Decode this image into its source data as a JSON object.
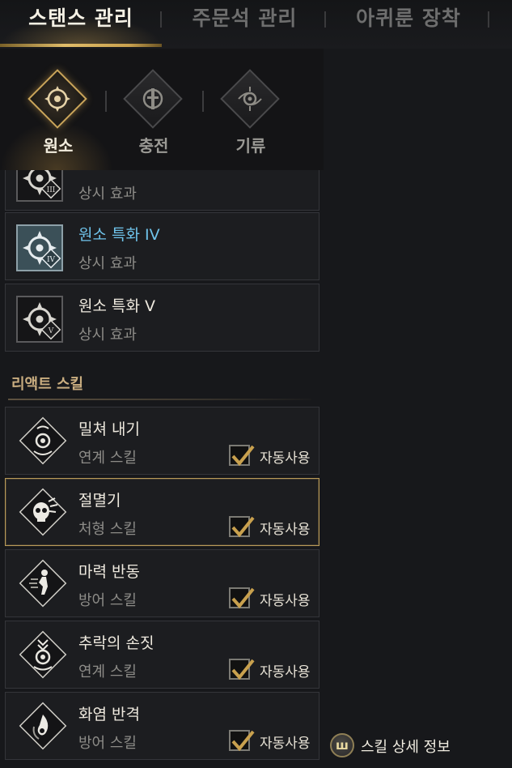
{
  "top_tabs": [
    {
      "label": "스탠스 관리",
      "active": true
    },
    {
      "label": "주문석 관리",
      "active": false
    },
    {
      "label": "아퀴룬 장착",
      "active": false
    }
  ],
  "stances": [
    {
      "label": "원소",
      "icon": "element-stance-icon",
      "active": true
    },
    {
      "label": "충전",
      "icon": "charge-stance-icon",
      "active": false
    },
    {
      "label": "기류",
      "icon": "airflow-stance-icon",
      "active": false
    }
  ],
  "passives": [
    {
      "name": "",
      "sub": "상시 효과",
      "icon": "element-mastery-iii-icon",
      "numeral": "III"
    },
    {
      "name": "원소 특화 IV",
      "sub": "상시 효과",
      "icon": "element-mastery-iv-icon",
      "numeral": "IV",
      "selected": true
    },
    {
      "name": "원소 특화 V",
      "sub": "상시 효과",
      "icon": "element-mastery-v-icon",
      "numeral": "V"
    }
  ],
  "react_section": {
    "title": "리액트 스킬"
  },
  "react_skills": [
    {
      "name": "밀쳐 내기",
      "type": "연계 스킬",
      "auto_label": "자동사용",
      "auto": true,
      "icon": "push-away-icon"
    },
    {
      "name": "절멸기",
      "type": "처형 스킬",
      "auto_label": "자동사용",
      "auto": true,
      "icon": "annihilation-skull-icon",
      "highlighted": true
    },
    {
      "name": "마력 반동",
      "type": "방어 스킬",
      "auto_label": "자동사용",
      "auto": true,
      "icon": "mana-recoil-icon"
    },
    {
      "name": "추락의 손짓",
      "type": "연계 스킬",
      "auto_label": "자동사용",
      "auto": true,
      "icon": "falling-gesture-icon"
    },
    {
      "name": "화염 반격",
      "type": "방어 스킬",
      "auto_label": "자동사용",
      "auto": true,
      "icon": "flame-counter-icon"
    }
  ],
  "detail_button": {
    "label": "스킬 상세 정보",
    "key": "ш"
  },
  "colors": {
    "accent_gold": "#c9a14e",
    "selected_blue": "#6fc3ea"
  }
}
